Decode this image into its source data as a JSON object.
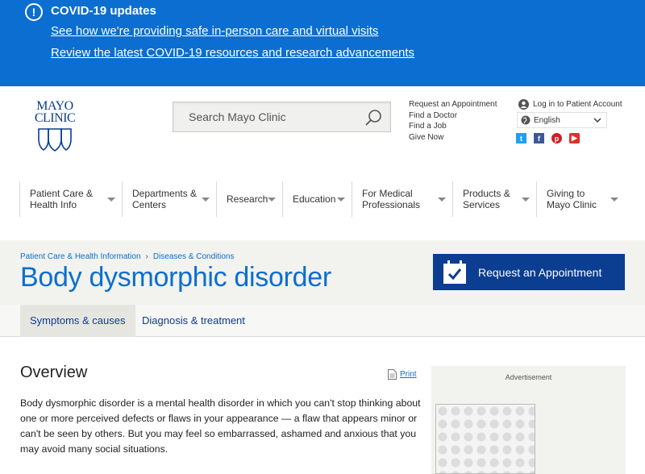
{
  "covid": {
    "title": "COVID-19 updates",
    "link1": "See how we're providing safe in-person care and virtual visits",
    "link2": "Review the latest COVID-19 resources and research advancements"
  },
  "logo": {
    "line1": "MAYO",
    "line2": "CLINIC"
  },
  "search": {
    "placeholder": "Search Mayo Clinic"
  },
  "quick_links": [
    "Request an Appointment",
    "Find a Doctor",
    "Find a Job",
    "Give Now"
  ],
  "account": {
    "label": "Log in to Patient Account"
  },
  "language": {
    "selected": "English"
  },
  "social": [
    "twitter-icon",
    "facebook-icon",
    "pinterest-icon",
    "youtube-icon"
  ],
  "nav": [
    {
      "line1": "Patient Care &",
      "line2": "Health Info"
    },
    {
      "line1": "Departments &",
      "line2": "Centers"
    },
    {
      "line1": "Research",
      "line2": ""
    },
    {
      "line1": "Education",
      "line2": ""
    },
    {
      "line1": "For Medical",
      "line2": "Professionals"
    },
    {
      "line1": "Products &",
      "line2": "Services"
    },
    {
      "line1": "Giving to",
      "line2": "Mayo Clinic"
    }
  ],
  "breadcrumb": [
    "Patient Care & Health Information",
    "Diseases & Conditions"
  ],
  "page_title": "Body dysmorphic disorder",
  "appointment_button": "Request an Appointment",
  "tabs": [
    "Symptoms & causes",
    "Diagnosis & treatment"
  ],
  "section_title": "Overview",
  "print_label": "Print",
  "body": "Body dysmorphic disorder is a mental health disorder in which you can't stop thinking about one or more perceived defects or flaws in your appearance — a flaw that appears minor or can't be seen by others. But you may feel so embarrassed, ashamed and anxious that you may avoid many social situations.",
  "advertisement_label": "Advertisement",
  "colors": {
    "banner": "#0b6ed0",
    "brand_dark": "#0b3d91",
    "link": "#0b6ed0"
  }
}
